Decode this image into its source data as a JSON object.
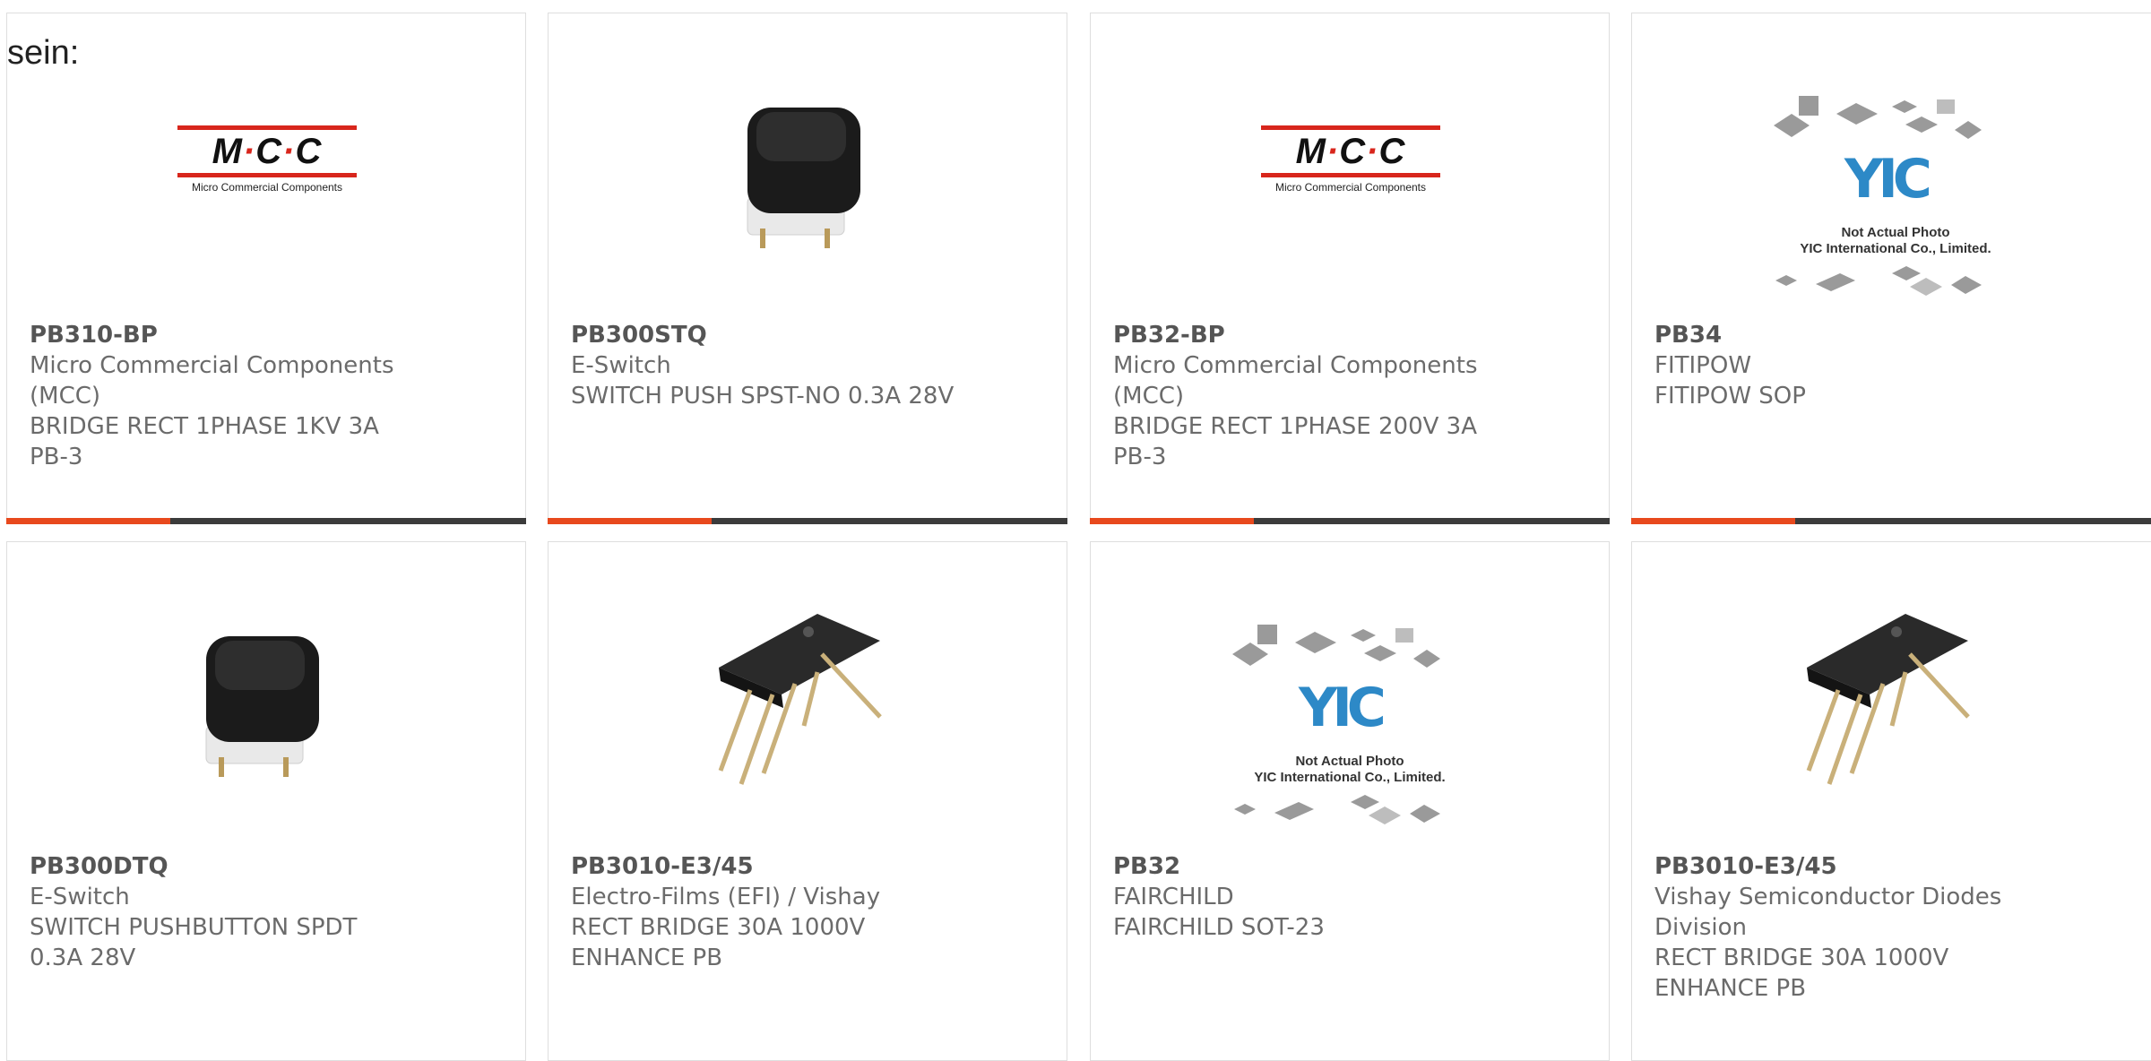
{
  "lead_text": "sein:",
  "colors": {
    "accent": "#e8491d",
    "bar": "#3b3b3b",
    "mcc_red": "#d8261c",
    "yic_blue": "#2d89c7"
  },
  "cards": [
    {
      "part": "PB310-BP",
      "maker_line1": "Micro Commercial Components",
      "maker_line2": "(MCC)",
      "desc_line1": "BRIDGE RECT 1PHASE 1KV 3A",
      "desc_line2": "PB-3",
      "image": "mcc-logo",
      "logo_letters": "M·C·C",
      "logo_tag": "Micro Commercial Components"
    },
    {
      "part": "PB300STQ",
      "maker_line1": "E-Switch",
      "maker_line2": "",
      "desc_line1": "SWITCH PUSH SPST-NO 0.3A 28V",
      "desc_line2": "",
      "image": "pushbutton-photo"
    },
    {
      "part": "PB32-BP",
      "maker_line1": "Micro Commercial Components",
      "maker_line2": "(MCC)",
      "desc_line1": "BRIDGE RECT 1PHASE 200V 3A",
      "desc_line2": "PB-3",
      "image": "mcc-logo",
      "logo_letters": "M·C·C",
      "logo_tag": "Micro Commercial Components"
    },
    {
      "part": "PB34",
      "maker_line1": "FITIPOW",
      "maker_line2": "",
      "desc_line1": "FITIPOW SOP",
      "desc_line2": "",
      "image": "yic-placeholder",
      "placeholder_line1": "Not Actual Photo",
      "placeholder_line2": "YIC International Co., Limited."
    },
    {
      "part": "PB300DTQ",
      "maker_line1": "E-Switch",
      "maker_line2": "",
      "desc_line1": "SWITCH PUSHBUTTON SPDT",
      "desc_line2": "0.3A 28V",
      "image": "pushbutton-photo"
    },
    {
      "part": "PB3010-E3/45",
      "maker_line1": "Electro-Films (EFI) / Vishay",
      "maker_line2": "",
      "desc_line1": "RECT BRIDGE 30A 1000V",
      "desc_line2": "ENHANCE PB",
      "image": "bridge-rectifier-photo"
    },
    {
      "part": "PB32",
      "maker_line1": "FAIRCHILD",
      "maker_line2": "",
      "desc_line1": "FAIRCHILD SOT-23",
      "desc_line2": "",
      "image": "yic-placeholder",
      "placeholder_line1": "Not Actual Photo",
      "placeholder_line2": "YIC International Co., Limited."
    },
    {
      "part": "PB3010-E3/45",
      "maker_line1": "Vishay Semiconductor Diodes",
      "maker_line2": "Division",
      "desc_line1": "RECT BRIDGE 30A 1000V",
      "desc_line2": "ENHANCE PB",
      "image": "bridge-rectifier-photo"
    }
  ]
}
